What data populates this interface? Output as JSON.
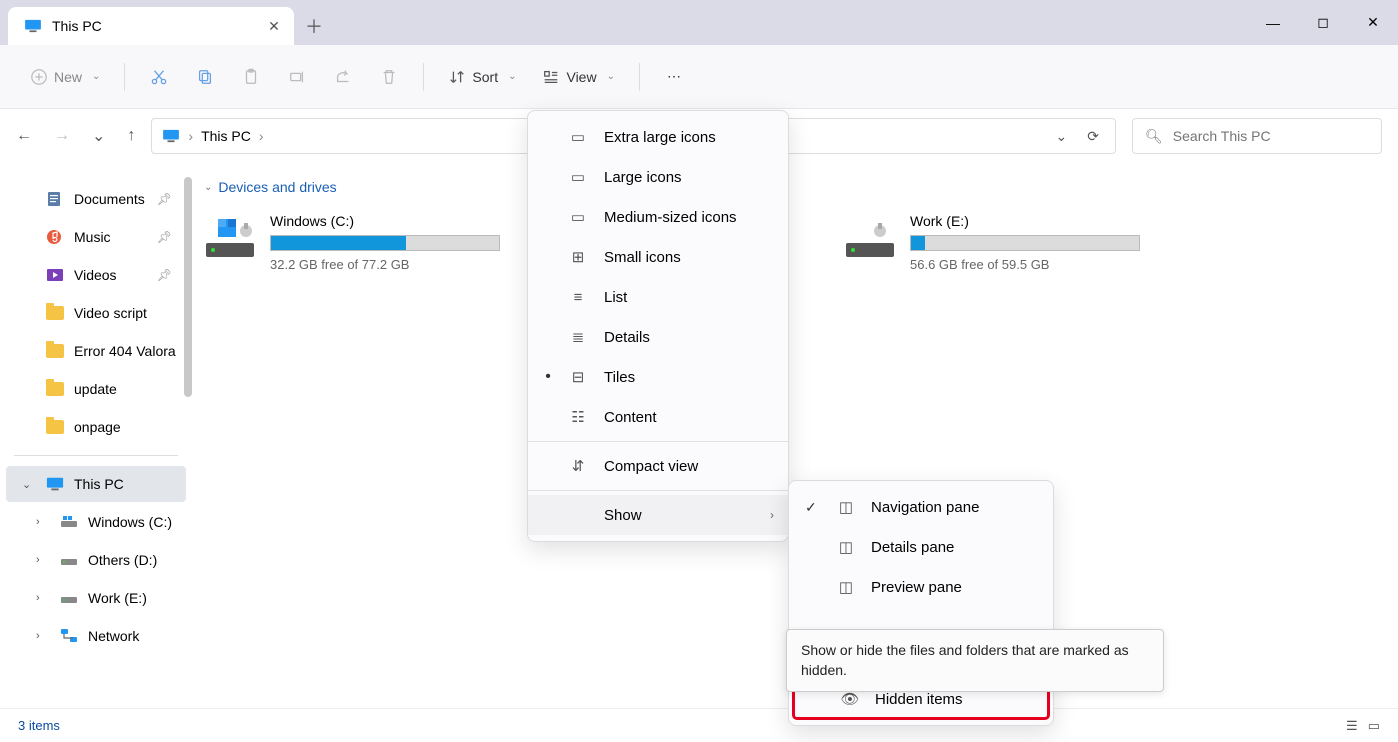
{
  "window": {
    "title": "This PC"
  },
  "toolbar": {
    "new_label": "New",
    "sort_label": "Sort",
    "view_label": "View"
  },
  "breadcrumb": {
    "root": "This PC"
  },
  "search": {
    "placeholder": "Search This PC"
  },
  "sidebar": {
    "quick": [
      {
        "label": "Documents",
        "pinned": true,
        "icon": "documents"
      },
      {
        "label": "Music",
        "pinned": true,
        "icon": "music"
      },
      {
        "label": "Videos",
        "pinned": true,
        "icon": "videos"
      },
      {
        "label": "Video script",
        "pinned": false,
        "icon": "folder"
      },
      {
        "label": "Error 404 Valora",
        "pinned": false,
        "icon": "folder"
      },
      {
        "label": "update",
        "pinned": false,
        "icon": "folder"
      },
      {
        "label": "onpage",
        "pinned": false,
        "icon": "folder"
      }
    ],
    "thispc_label": "This PC",
    "drives": [
      {
        "label": "Windows (C:)"
      },
      {
        "label": "Others (D:)"
      },
      {
        "label": "Work (E:)"
      }
    ],
    "network_label": "Network"
  },
  "content": {
    "group_label": "Devices and drives",
    "drives": [
      {
        "name": "Windows (C:)",
        "free_text": "32.2 GB free of 77.2 GB",
        "fill_pct": 59
      },
      {
        "name": "Work (E:)",
        "free_text": "56.6 GB free of 59.5 GB",
        "fill_pct": 6
      }
    ]
  },
  "view_menu": {
    "items": [
      {
        "label": "Extra large icons",
        "bullet": false,
        "icon": "xl"
      },
      {
        "label": "Large icons",
        "bullet": false,
        "icon": "lg"
      },
      {
        "label": "Medium-sized icons",
        "bullet": false,
        "icon": "md"
      },
      {
        "label": "Small icons",
        "bullet": false,
        "icon": "sm"
      },
      {
        "label": "List",
        "bullet": false,
        "icon": "list"
      },
      {
        "label": "Details",
        "bullet": false,
        "icon": "details"
      },
      {
        "label": "Tiles",
        "bullet": true,
        "icon": "tiles"
      },
      {
        "label": "Content",
        "bullet": false,
        "icon": "content"
      }
    ],
    "compact_label": "Compact view",
    "show_label": "Show"
  },
  "show_menu": {
    "items": [
      {
        "label": "Navigation pane",
        "checked": true
      },
      {
        "label": "Details pane",
        "checked": false
      },
      {
        "label": "Preview pane",
        "checked": false
      }
    ],
    "hidden_label": "Hidden items"
  },
  "tooltip": {
    "text": "Show or hide the files and folders that are marked as hidden."
  },
  "status": {
    "text": "3 items"
  }
}
